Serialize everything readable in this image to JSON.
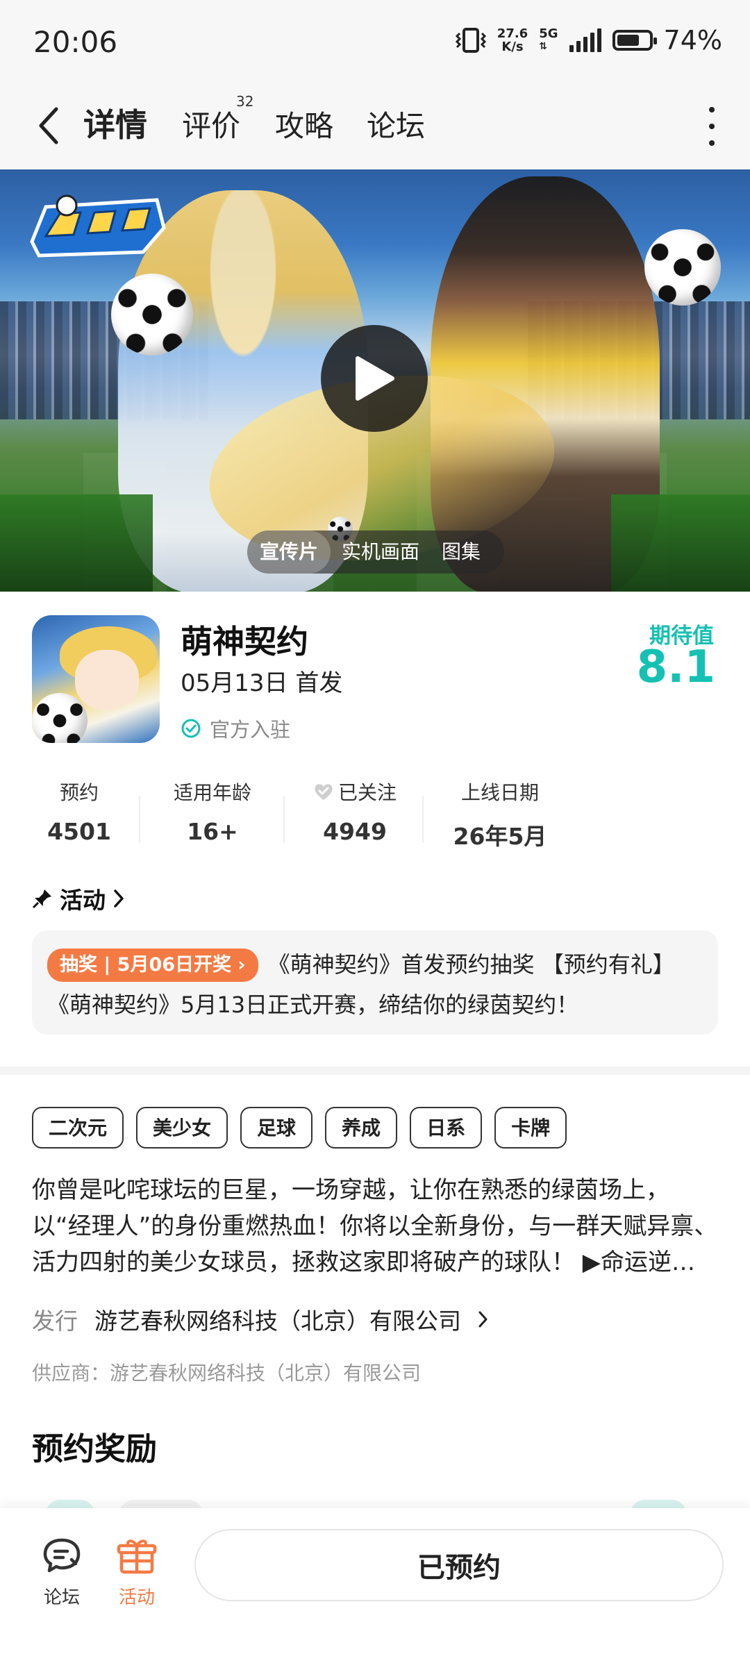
{
  "status_bar": {
    "time": "20:06",
    "speed_value": "27.6",
    "speed_unit": "K/s",
    "network": "5G",
    "battery_percent": "74%",
    "battery_level": 0.74
  },
  "nav": {
    "tabs": [
      {
        "label": "详情"
      },
      {
        "label": "评价"
      },
      {
        "label": "攻略"
      },
      {
        "label": "论坛"
      }
    ],
    "review_count": "32"
  },
  "banner": {
    "media_tabs": [
      "宣传片",
      "实机画面",
      "图集"
    ]
  },
  "app": {
    "name": "萌神契约",
    "release": "05月13日 首发",
    "official_label": "官方入驻",
    "expect_label": "期待值",
    "expect_score": "8.1"
  },
  "stats": [
    {
      "label": "预约",
      "value": "4501"
    },
    {
      "label": "适用年龄",
      "value": "16+"
    },
    {
      "label": "已关注",
      "value": "4949"
    },
    {
      "label": "上线日期",
      "value": "26年5月"
    }
  ],
  "activity": {
    "heading": "活动",
    "badge": "抽奖 | 5月06日开奖",
    "text": "《萌神契约》首发预约抽奖 【预约有礼】《萌神契约》5月13日正式开赛，缔结你的绿茵契约！"
  },
  "tags": [
    "二次元",
    "美少女",
    "足球",
    "养成",
    "日系",
    "卡牌"
  ],
  "description": "你曾是叱咤球坛的巨星，一场穿越，让你在熟悉的绿茵场上，以“经理人”的身份重燃热血！你将以全新身份，与一群天赋异禀、活力四射的美少女球员，拯救这家即将破产的球队！ ▶命运逆…",
  "publisher": {
    "key": "发行",
    "value": "游艺春秋网络科技（北京）有限公司"
  },
  "supplier": "供应商：游艺春秋网络科技（北京）有限公司",
  "reward_title": "预约奖励",
  "bottom": {
    "forum_label": "论坛",
    "activity_label": "活动",
    "reserve_label": "已预约"
  },
  "colors": {
    "accent_teal": "#15c1b3",
    "tab_underline": "#2ad3c3",
    "activity_orange": "#f47a44"
  }
}
